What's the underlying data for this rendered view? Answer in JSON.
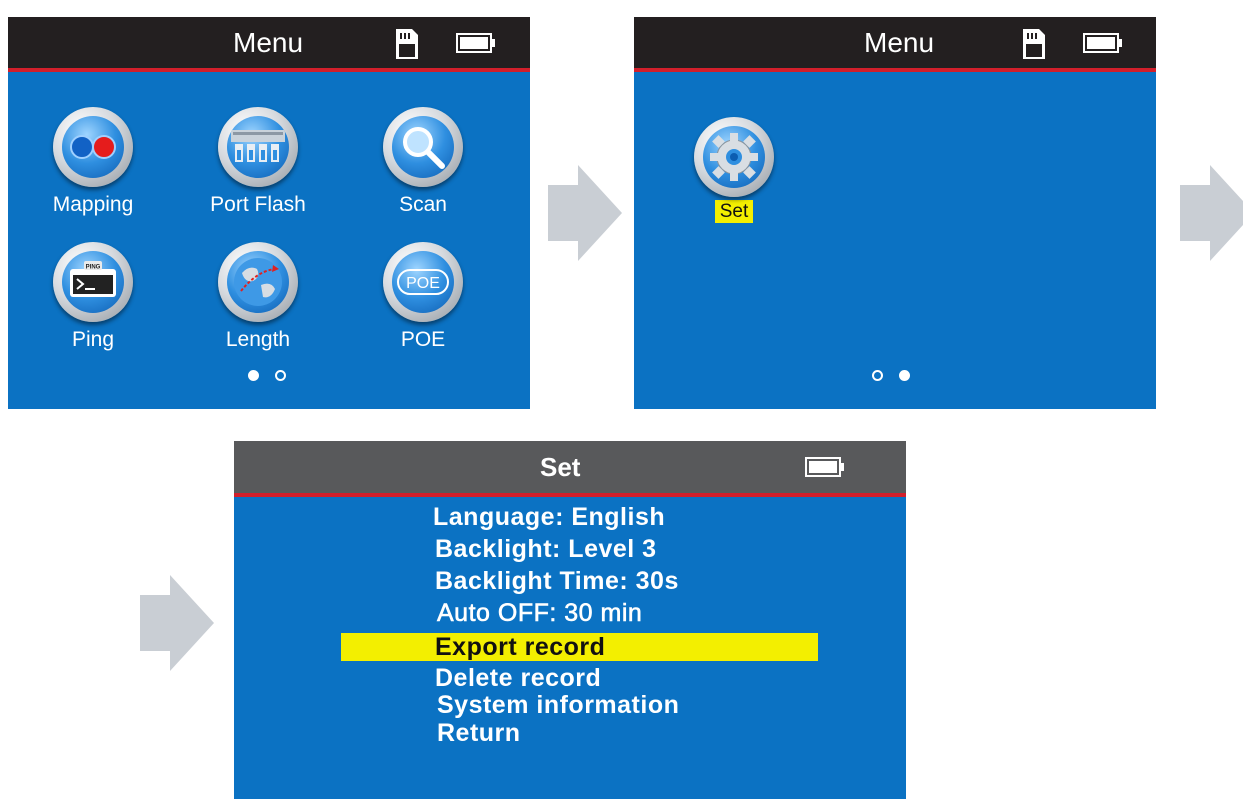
{
  "screen1": {
    "title": "Menu",
    "apps": [
      {
        "label": "Mapping",
        "icon": "mapping-icon"
      },
      {
        "label": "Port Flash",
        "icon": "port-flash-icon"
      },
      {
        "label": "Scan",
        "icon": "scan-icon"
      },
      {
        "label": "Ping",
        "icon": "ping-icon"
      },
      {
        "label": "Length",
        "icon": "length-icon"
      },
      {
        "label": "POE",
        "icon": "poe-icon"
      }
    ],
    "ping_badge": "PING",
    "poe_badge": "POE",
    "page_indicator": {
      "pages": 2,
      "current": 1
    }
  },
  "screen2": {
    "title": "Menu",
    "apps": [
      {
        "label": "Set",
        "icon": "gear-icon",
        "selected": true
      }
    ],
    "page_indicator": {
      "pages": 2,
      "current": 2
    }
  },
  "screen3": {
    "title": "Set",
    "items": [
      "Language: English",
      "Backlight: Level 3",
      "Backlight Time: 30s",
      "Auto OFF: 30 min",
      "Export record",
      "Delete record",
      "System information",
      "Return"
    ],
    "selected_index": 4
  },
  "colors": {
    "screen_bg": "#0b72c3",
    "titlebar": "#231f20",
    "set_titlebar": "#58595b",
    "accent_line": "#d21f2b",
    "highlight": "#f3ef00",
    "arrow": "#c9ced4"
  }
}
